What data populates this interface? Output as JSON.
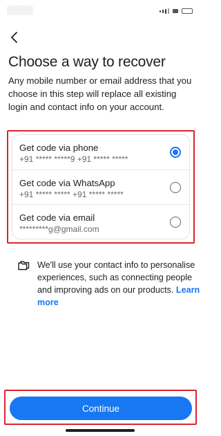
{
  "header": {
    "back_icon": "chevron-left-icon",
    "title": "Choose a way to recover",
    "description": "Any mobile number or email address that you choose in this step will replace all existing login and contact info on your account."
  },
  "options": [
    {
      "label": "Get code via phone",
      "detail": "+91 ***** *****9 +91 ***** *****",
      "selected": true
    },
    {
      "label": "Get code via WhatsApp",
      "detail": "+91 ***** ***** +91 ***** *****",
      "selected": false
    },
    {
      "label": "Get code via email",
      "detail": "*********g@gmail.com",
      "selected": false
    }
  ],
  "info": {
    "icon": "folders-icon",
    "text": "We'll use your contact info to personalise experiences, such as connecting people and improving ads on our products.",
    "link": "Learn more"
  },
  "footer": {
    "continue_label": "Continue"
  },
  "colors": {
    "accent": "#1877f2",
    "highlight_border": "#d9242f"
  }
}
